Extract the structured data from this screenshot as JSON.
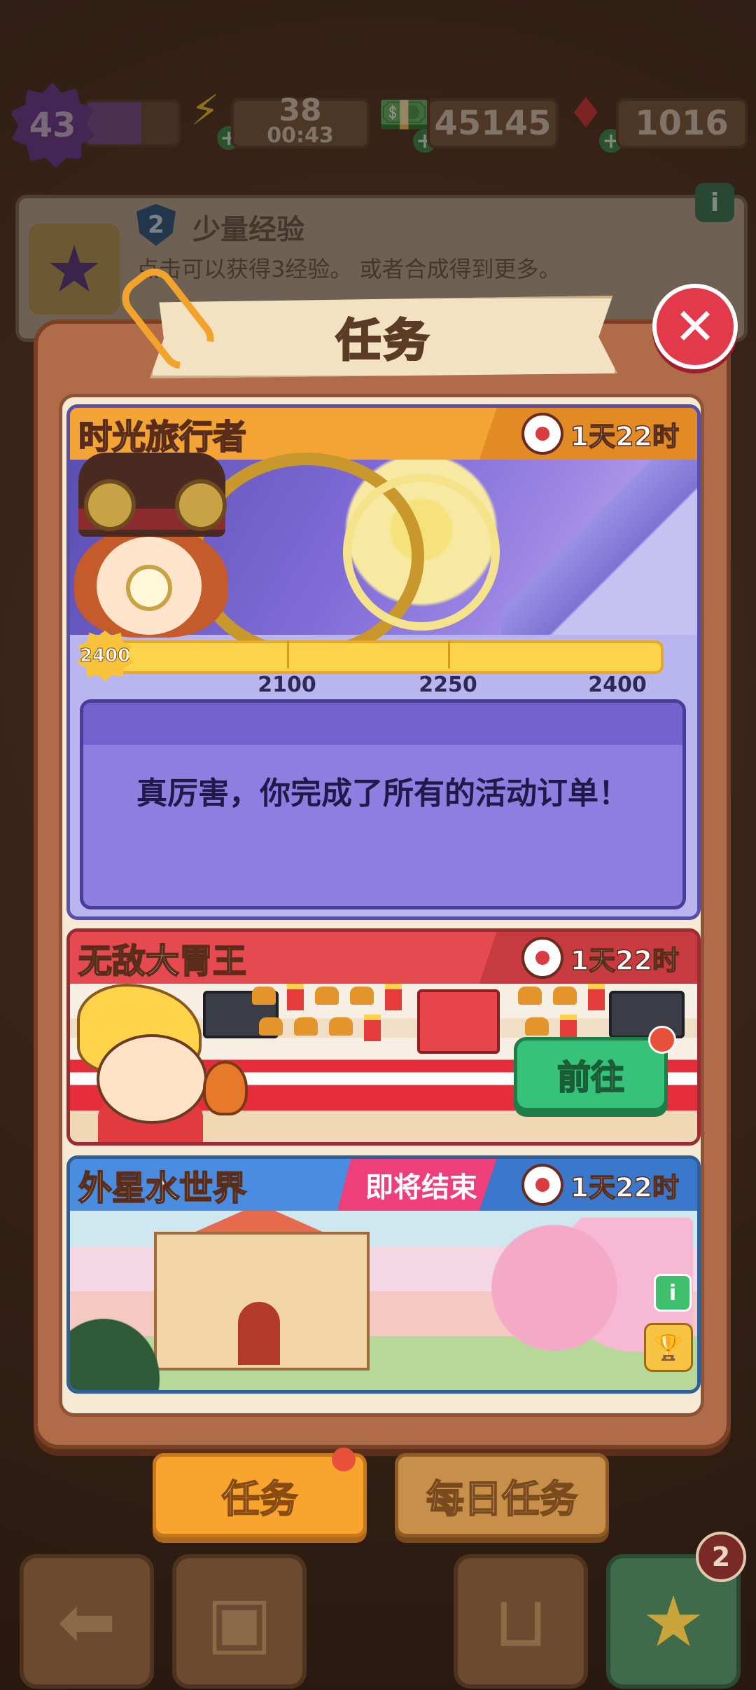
{
  "hud": {
    "level": "43",
    "energy": "38",
    "energy_timer": "00:43",
    "cash": "45145",
    "gems": "1016"
  },
  "info_bar": {
    "badge": "2",
    "title": "少量经验",
    "description": "点击可以获得3经验。 或者合成得到更多。"
  },
  "panel": {
    "title": "任务",
    "events": [
      {
        "title": "时光旅行者",
        "timer": "1天22时",
        "progress_badge": "2400",
        "progress_fraction": 1.0,
        "milestones": [
          "2100",
          "2250",
          "2400"
        ],
        "completed_message": "真厉害，你完成了所有的活动订单！"
      },
      {
        "title": "无敌大胃王",
        "timer": "1天22时",
        "go_button": "前往"
      },
      {
        "title": "外星水世界",
        "ending_tag": "即将结束",
        "timer": "1天22时"
      }
    ]
  },
  "tabs": {
    "tasks": "任务",
    "daily_tasks": "每日任务"
  },
  "bottom_nav": {
    "star_badge": "2"
  },
  "colors": {
    "header_orange": "#f4a434",
    "header_red": "#e44a50",
    "header_blue": "#4a8de0",
    "go_green": "#37c27a",
    "close_red": "#e23a4a"
  }
}
